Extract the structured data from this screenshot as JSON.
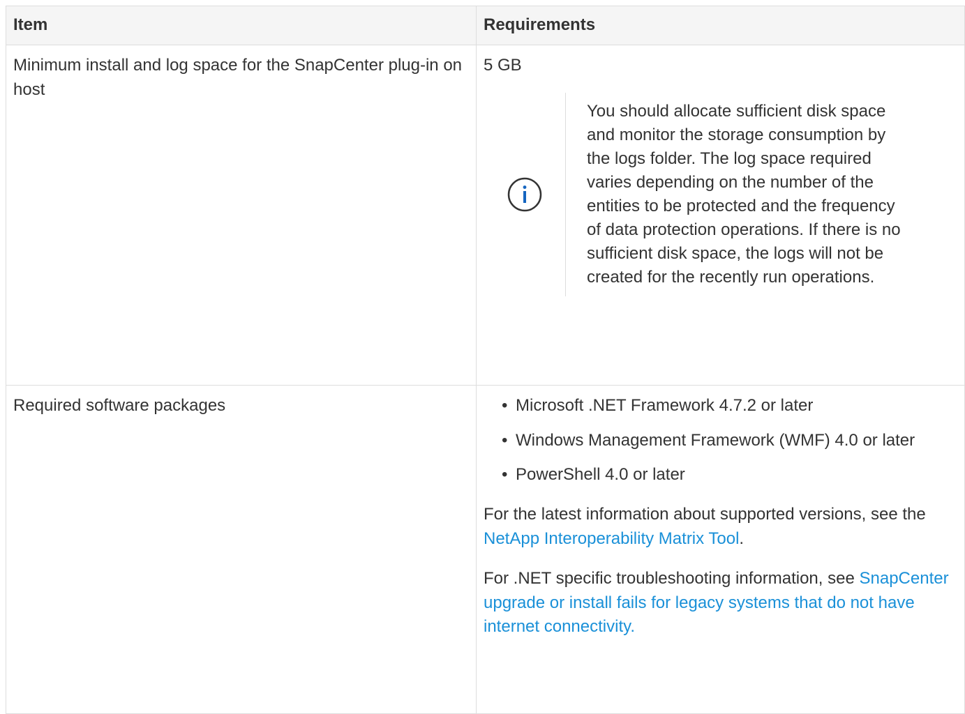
{
  "table": {
    "headers": {
      "item": "Item",
      "requirements": "Requirements"
    },
    "rows": [
      {
        "item": "Minimum install and log space for the SnapCenter plug-in on host",
        "value": "5 GB",
        "note": {
          "icon": "info-icon",
          "text": "You should allocate sufficient disk space and monitor the storage consumption by the logs folder. The log space required varies depending on the number of the entities to be protected and the frequency of data protection operations. If there is no sufficient disk space, the logs will not be created for the recently run operations."
        }
      },
      {
        "item": "Required software packages",
        "packages": [
          "Microsoft .NET Framework 4.7.2 or later",
          "Windows Management Framework (WMF) 4.0 or later",
          "PowerShell 4.0 or later"
        ],
        "latest_info": {
          "before": "For the latest information about supported versions, see the ",
          "link": "NetApp Interoperability Matrix Tool",
          "after": "."
        },
        "troubleshooting": {
          "before": "For .NET specific troubleshooting information, see ",
          "link": "SnapCenter upgrade or install fails for legacy systems that do not have internet connectivity."
        }
      }
    ]
  },
  "colors": {
    "link": "#1a90d8",
    "info_icon": "#1565c0",
    "border": "#dddddd",
    "header_bg": "#f5f5f5"
  }
}
